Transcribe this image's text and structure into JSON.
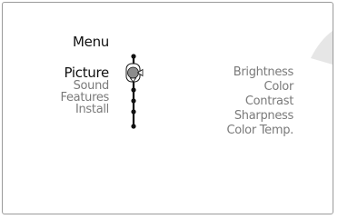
{
  "menu": {
    "title": "Menu",
    "items": [
      {
        "label": "Picture",
        "selected": true
      },
      {
        "label": "Sound",
        "selected": false
      },
      {
        "label": "Features",
        "selected": false
      },
      {
        "label": "Install",
        "selected": false
      }
    ]
  },
  "submenu": {
    "items": [
      {
        "label": "Brightness"
      },
      {
        "label": "Color"
      },
      {
        "label": "Contrast"
      },
      {
        "label": "Sharpness"
      },
      {
        "label": "Color Temp."
      }
    ]
  },
  "colors": {
    "selected_text": "#111111",
    "unselected_text": "#7a7a7a",
    "cursor_fill": "#8c8c8c",
    "corner_shape": "#e6e6e6",
    "frame_border": "#9a9a9a"
  },
  "icons": {
    "cursor": "navigation-cursor-icon",
    "arrow_right": "arrow-right-icon",
    "arrow_down": "arrow-down-icon"
  }
}
